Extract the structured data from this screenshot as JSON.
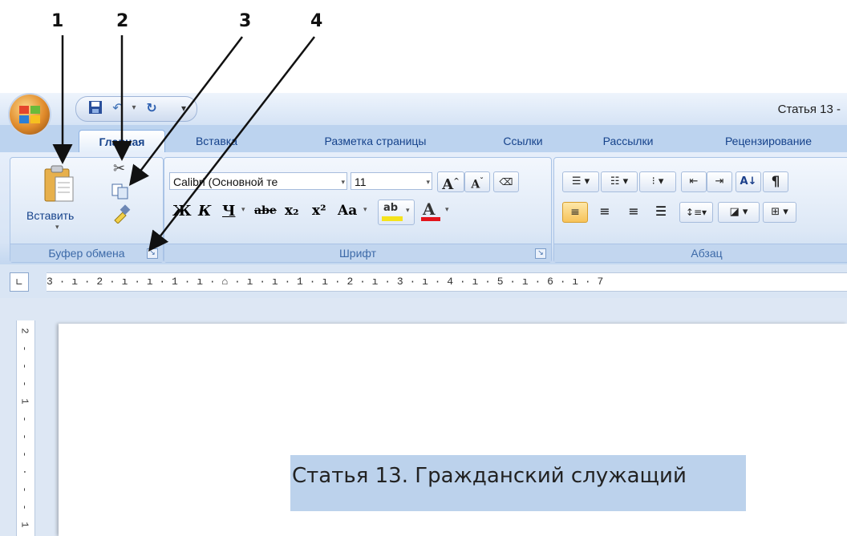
{
  "callouts": [
    "1",
    "2",
    "3",
    "4"
  ],
  "title_bar": {
    "window_title": "Статья 13 -",
    "office_button_icon": "office-logo-icon",
    "quick_access": {
      "save_icon": "save-icon",
      "undo_icon": "undo-icon",
      "redo_icon": "redo-icon",
      "customize_icon": "customize-qat-icon"
    }
  },
  "tabs": [
    "Главная",
    "Вставка",
    "Разметка страницы",
    "Ссылки",
    "Рассылки",
    "Рецензирование"
  ],
  "active_tab": "Главная",
  "ribbon": {
    "clipboard": {
      "label": "Буфер обмена",
      "paste_label": "Вставить",
      "cut_icon": "scissors-icon",
      "copy_icon": "copy-icon",
      "format_painter_icon": "format-painter-icon"
    },
    "font": {
      "label": "Шрифт",
      "font_name": "Calibri (Основной те",
      "font_size": "11",
      "grow_label": "A",
      "shrink_label": "A",
      "bold": "Ж",
      "italic": "К",
      "underline": "Ч",
      "strikethrough": "abe",
      "subscript": "x₂",
      "superscript": "x²",
      "change_case": "Aa",
      "highlight": "ab",
      "font_color": "A",
      "highlight_color": "#f5e31c",
      "font_color_bar": "#e3141c"
    },
    "paragraph": {
      "label": "Абзац",
      "sort_label": "А↓",
      "pilcrow": "¶"
    }
  },
  "ruler_text": "3 · ı · 2 · ı · ı · 1 · ı · ⌂ · ı · ı · 1 · ı · 2 · ı · 3 · ı · 4 · ı · 5 · ı · 6 · ı · 7",
  "vertical_ruler_marks": [
    "2",
    "-",
    "-",
    "-",
    "1",
    "-",
    "-",
    "-",
    "·",
    "-",
    "-",
    "1"
  ],
  "document": {
    "text": "Статья 13. Гражданский служащий",
    "selection_color": "#bcd2ec"
  }
}
